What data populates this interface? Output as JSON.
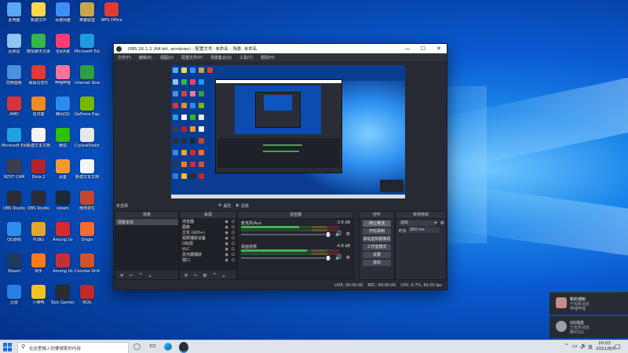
{
  "desktop_icons": [
    {
      "label": "此电脑",
      "color": "#5aa9f0",
      "col": 0,
      "row": 0
    },
    {
      "label": "新建文件",
      "color": "#ffd84a",
      "col": 1,
      "row": 0
    },
    {
      "label": "百度网盘",
      "color": "#3e8ef7",
      "col": 2,
      "row": 0
    },
    {
      "label": "英雄联盟",
      "color": "#c9a64a",
      "col": 3,
      "row": 0
    },
    {
      "label": "WPS Office",
      "color": "#e03c31",
      "col": 4,
      "row": 0
    },
    {
      "label": "回收站",
      "color": "#8ec5f2",
      "col": 0,
      "row": 1
    },
    {
      "label": "微信聊天记录",
      "color": "#35b84a",
      "col": 1,
      "row": 1
    },
    {
      "label": "全民K歌",
      "color": "#ff3d6e",
      "col": 2,
      "row": 1
    },
    {
      "label": "Microsoft Edge",
      "color": "#1e9be0",
      "col": 3,
      "row": 1
    },
    {
      "label": "控制面板",
      "color": "#4a90e2",
      "col": 0,
      "row": 2
    },
    {
      "label": "网易云音乐",
      "color": "#e33a32",
      "col": 1,
      "row": 2
    },
    {
      "label": "哔哩哔哩",
      "color": "#fb7299",
      "col": 2,
      "row": 2
    },
    {
      "label": "Internet Download",
      "color": "#2f9e44",
      "col": 3,
      "row": 2
    },
    {
      "label": "AMD",
      "color": "#d9343b",
      "col": 0,
      "row": 3
    },
    {
      "label": "向日葵",
      "color": "#f08a24",
      "col": 1,
      "row": 3
    },
    {
      "label": "腾讯QQ",
      "color": "#2a8bf2",
      "col": 2,
      "row": 3
    },
    {
      "label": "GeForce Experience",
      "color": "#76b900",
      "col": 3,
      "row": 3
    },
    {
      "label": "Microsoft Edge",
      "color": "#1ea1e6",
      "col": 0,
      "row": 4
    },
    {
      "label": "新建文本文档",
      "color": "#f4f4f4",
      "col": 1,
      "row": 4
    },
    {
      "label": "微信",
      "color": "#2dc100",
      "col": 2,
      "row": 4
    },
    {
      "label": "CrystalDiskInfo",
      "color": "#e8e8e8",
      "col": 3,
      "row": 4
    },
    {
      "label": "NZXT CAM",
      "color": "#3b3f4d",
      "col": 0,
      "row": 5
    },
    {
      "label": "Dota 2",
      "color": "#b5232a",
      "col": 1,
      "row": 5
    },
    {
      "label": "设置",
      "color": "#f29a2e",
      "col": 2,
      "row": 5
    },
    {
      "label": "新建文本文档",
      "color": "#f4f4f4",
      "col": 3,
      "row": 5
    },
    {
      "label": "OBS Studio",
      "color": "#2a2d36",
      "col": 0,
      "row": 6
    },
    {
      "label": "OBS Studio",
      "color": "#2a2d36",
      "col": 1,
      "row": 6
    },
    {
      "label": "steam",
      "color": "#1b2838",
      "col": 2,
      "row": 6
    },
    {
      "label": "绝地求生",
      "color": "#c8452f",
      "col": 3,
      "row": 6
    },
    {
      "label": "QQ游戏",
      "color": "#2f8df0",
      "col": 0,
      "row": 7
    },
    {
      "label": "PUBG",
      "color": "#e0a92d",
      "col": 1,
      "row": 7
    },
    {
      "label": "Among Us",
      "color": "#d8282e",
      "col": 2,
      "row": 7
    },
    {
      "label": "Origin",
      "color": "#f56c2d",
      "col": 3,
      "row": 7
    },
    {
      "label": "Steam",
      "color": "#1f3a5a",
      "col": 0,
      "row": 8
    },
    {
      "label": "快手",
      "color": "#ff7a1a",
      "col": 1,
      "row": 8
    },
    {
      "label": "Among Us",
      "color": "#c92f32",
      "col": 2,
      "row": 8
    },
    {
      "label": "Counter-Strike",
      "color": "#d0552c",
      "col": 3,
      "row": 8
    },
    {
      "label": "迅雷",
      "color": "#2a7ee6",
      "col": 0,
      "row": 9
    },
    {
      "label": "小黄鸭",
      "color": "#f2c321",
      "col": 1,
      "row": 9
    },
    {
      "label": "Epic Games",
      "color": "#2c2c2c",
      "col": 2,
      "row": 9
    },
    {
      "label": "ROG",
      "color": "#c4262d",
      "col": 3,
      "row": 9
    }
  ],
  "obs": {
    "title": "OBS 26.1.1 (64-bit, windows) - 配置文件: 未命名 - 场景: 未命名",
    "menu": [
      "文件(F)",
      "编辑(E)",
      "视图(V)",
      "配置文件(P)",
      "场景集合(S)",
      "工具(T)",
      "帮助(H)"
    ],
    "scene_label": "未选择",
    "scene_props": "属性",
    "scene_filters": "滤镜",
    "docks": {
      "scenes": {
        "title": "场景",
        "items": [
          "场景本体"
        ]
      },
      "sources": {
        "title": "来源",
        "items": [
          "浏览器",
          "图像",
          "文本 (GDI+)",
          "视频捕获设备",
          "OBJ源",
          "VLC",
          "显示器捕获",
          "窗口"
        ]
      },
      "mixer": {
        "title": "混音器",
        "channels": [
          {
            "name": "麦克风/Aux",
            "db": "-3.8 dB",
            "level": 0.62
          },
          {
            "name": "桌面音频",
            "db": "-4.8 dB",
            "level": 0.7
          }
        ]
      },
      "controls": {
        "title": "控件",
        "buttons": [
          "停止推流",
          "开始录制",
          "启动虚拟摄像机",
          "工作室模式",
          "设置",
          "退出"
        ],
        "active_index": 0
      },
      "transitions": {
        "title": "转场特效",
        "type": "淡出",
        "duration_label": "时长",
        "duration": "300 ms"
      }
    },
    "status": {
      "live": "LIVE: 00:00:00",
      "rec": "REC: 00:00:00",
      "cpu": "CPU: 0.7%, 60.00 fps"
    },
    "window_buttons": [
      "—",
      "☐",
      "✕"
    ]
  },
  "taskbar": {
    "search_placeholder": "在这里输入你要搜索的内容",
    "time": "20:03",
    "date": "2021/8/5",
    "lang": "英"
  },
  "notifications": [
    {
      "title": "新的通知",
      "body": "已有新消息",
      "app": "哔哩哔哩"
    },
    {
      "title": "QQ消息",
      "body": "已有新消息",
      "app": "腾讯QQ"
    }
  ]
}
